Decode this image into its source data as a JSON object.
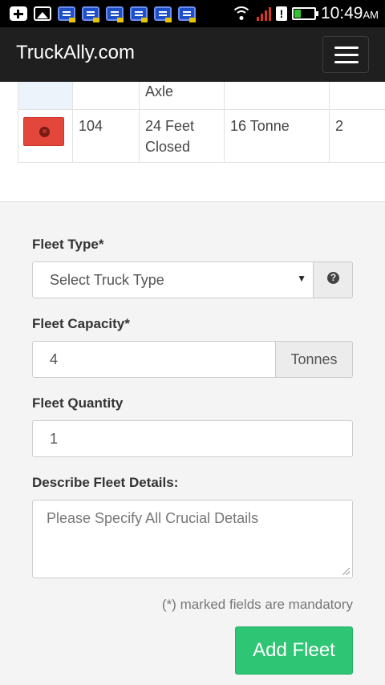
{
  "status_bar": {
    "time": "10:49",
    "time_suffix": "AM",
    "colors": {
      "signal": "#d23a2a",
      "battery": "#35c035",
      "message": "#1e4fc8"
    }
  },
  "navbar": {
    "brand": "TruckAlly.com",
    "menu_icon": "hamburger-menu-icon"
  },
  "fleet_table": {
    "partial_row": {
      "type_fragment": "Axle"
    },
    "rows": [
      {
        "id": "104",
        "type": "24 Feet Closed",
        "type_line1": "24 Feet",
        "type_line2": "Closed",
        "capacity": "16 Tonne",
        "quantity": "2",
        "delete_icon": "remove-icon"
      }
    ]
  },
  "form": {
    "fleet_type": {
      "label": "Fleet Type*",
      "selected": "Select Truck Type",
      "help_icon": "question-icon",
      "help_glyph": "?"
    },
    "fleet_capacity": {
      "label": "Fleet Capacity*",
      "value": "4",
      "unit": "Tonnes"
    },
    "fleet_quantity": {
      "label": "Fleet Quantity",
      "value": "1"
    },
    "details": {
      "label": "Describe Fleet Details:",
      "placeholder": "Please Specify All Crucial Details"
    },
    "mandatory_note": "(*) marked fields are mandatory",
    "submit_label": "Add Fleet"
  },
  "colors": {
    "navbar": "#1f1f1f",
    "delete_button": "#e3463b",
    "submit_button": "#2ec574"
  }
}
